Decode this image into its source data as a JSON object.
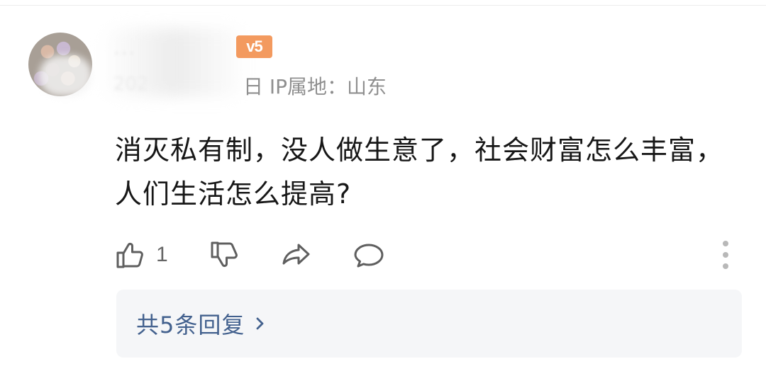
{
  "header": {
    "ip_label": "日 IP属地：山东",
    "level_badge": "v5"
  },
  "user": {
    "avatar_icon": "user-avatar-icon",
    "name_partial": "..."
  },
  "comment": {
    "text": "消灭私有制，没人做生意了，社会财富怎么丰富，人们生活怎么提高?"
  },
  "actions": {
    "like_icon": "thumb-up-icon",
    "like_count": "1",
    "dislike_icon": "thumb-down-icon",
    "share_icon": "share-icon",
    "reply_icon": "comment-icon",
    "more_icon": "more-vertical-icon"
  },
  "replies": {
    "summary": "共5条回复",
    "chevron_icon": "chevron-right-icon"
  }
}
